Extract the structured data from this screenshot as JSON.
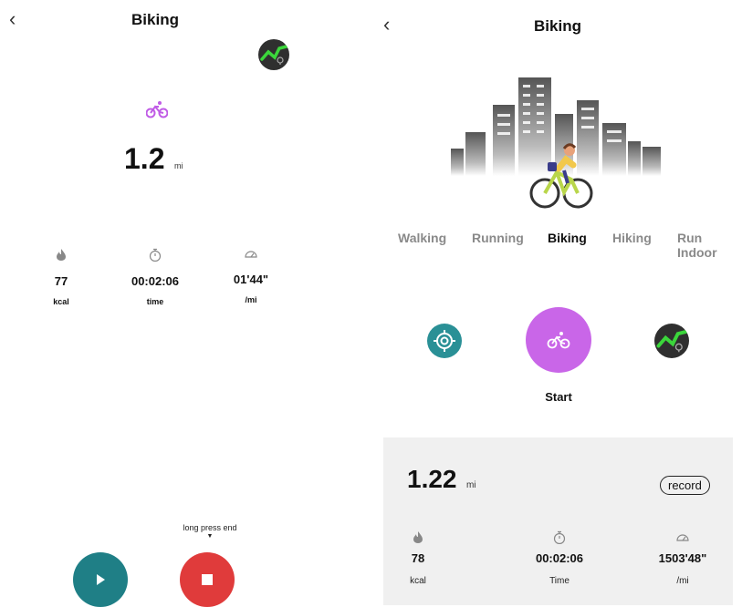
{
  "left": {
    "title": "Biking",
    "distance": "1.2",
    "distance_unit": "mi",
    "stats": [
      {
        "icon": "flame-icon",
        "value": "77",
        "label": "kcal"
      },
      {
        "icon": "stopwatch-icon",
        "value": "00:02:06",
        "label": "time"
      },
      {
        "icon": "speedometer-icon",
        "value": "01'44\"",
        "label": "/mi"
      }
    ],
    "hint": "long press end",
    "colors": {
      "play": "#1f7f86",
      "stop": "#e03b3b",
      "accent": "#c05ce6"
    }
  },
  "right": {
    "title": "Biking",
    "tabs": [
      "Walking",
      "Running",
      "Biking",
      "Hiking",
      "Run Indoor"
    ],
    "active_tab": "Biking",
    "start_label": "Start",
    "distance": "1.22",
    "distance_unit": "mi",
    "record_label": "record",
    "stats": [
      {
        "icon": "flame-icon",
        "value": "78",
        "label": "kcal"
      },
      {
        "icon": "stopwatch-icon",
        "value": "00:02:06",
        "label": "Time"
      },
      {
        "icon": "speedometer-icon",
        "value": "1503'48\"",
        "label": "/mi"
      }
    ],
    "colors": {
      "gps": "#2a9096",
      "start": "#c966e8",
      "panel": "#f0f0f0"
    }
  }
}
